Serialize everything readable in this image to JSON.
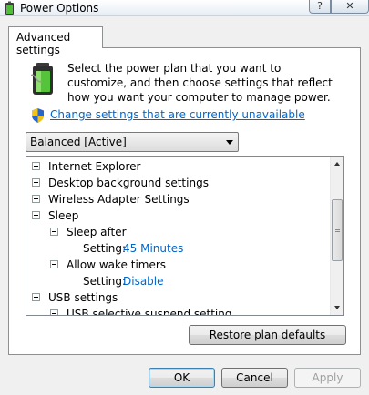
{
  "window": {
    "title": "Power Options",
    "help_label": "?",
    "close_label": "✕"
  },
  "tab": {
    "label": "Advanced settings"
  },
  "intro": {
    "text": "Select the power plan that you want to customize, and then choose settings that reflect how you want your computer to manage power."
  },
  "change_link": {
    "label": "Change settings that are currently unavailable"
  },
  "plan_dropdown": {
    "selected": "Balanced [Active]"
  },
  "tree": {
    "rows": [
      {
        "label": "Internet Explorer",
        "state": "collapsed",
        "level": 0
      },
      {
        "label": "Desktop background settings",
        "state": "collapsed",
        "level": 0
      },
      {
        "label": "Wireless Adapter Settings",
        "state": "collapsed",
        "level": 0
      },
      {
        "label": "Sleep",
        "state": "expanded",
        "level": 0
      },
      {
        "label": "Sleep after",
        "state": "expanded",
        "level": 1
      },
      {
        "setting_label": "Setting:",
        "value": "45 Minutes",
        "level": 2
      },
      {
        "label": "Allow wake timers",
        "state": "expanded",
        "level": 1
      },
      {
        "setting_label": "Setting:",
        "value": "Disable",
        "level": 2
      },
      {
        "label": "USB settings",
        "state": "expanded",
        "level": 0
      },
      {
        "label": "USB selective suspend setting",
        "state": "expanded",
        "level": 1
      }
    ]
  },
  "buttons": {
    "restore": "Restore plan defaults",
    "ok": "OK",
    "cancel": "Cancel",
    "apply": "Apply"
  },
  "colors": {
    "link": "#0066cc",
    "panel_bg": "#ffffff",
    "window_bg": "#f0f0f0"
  }
}
